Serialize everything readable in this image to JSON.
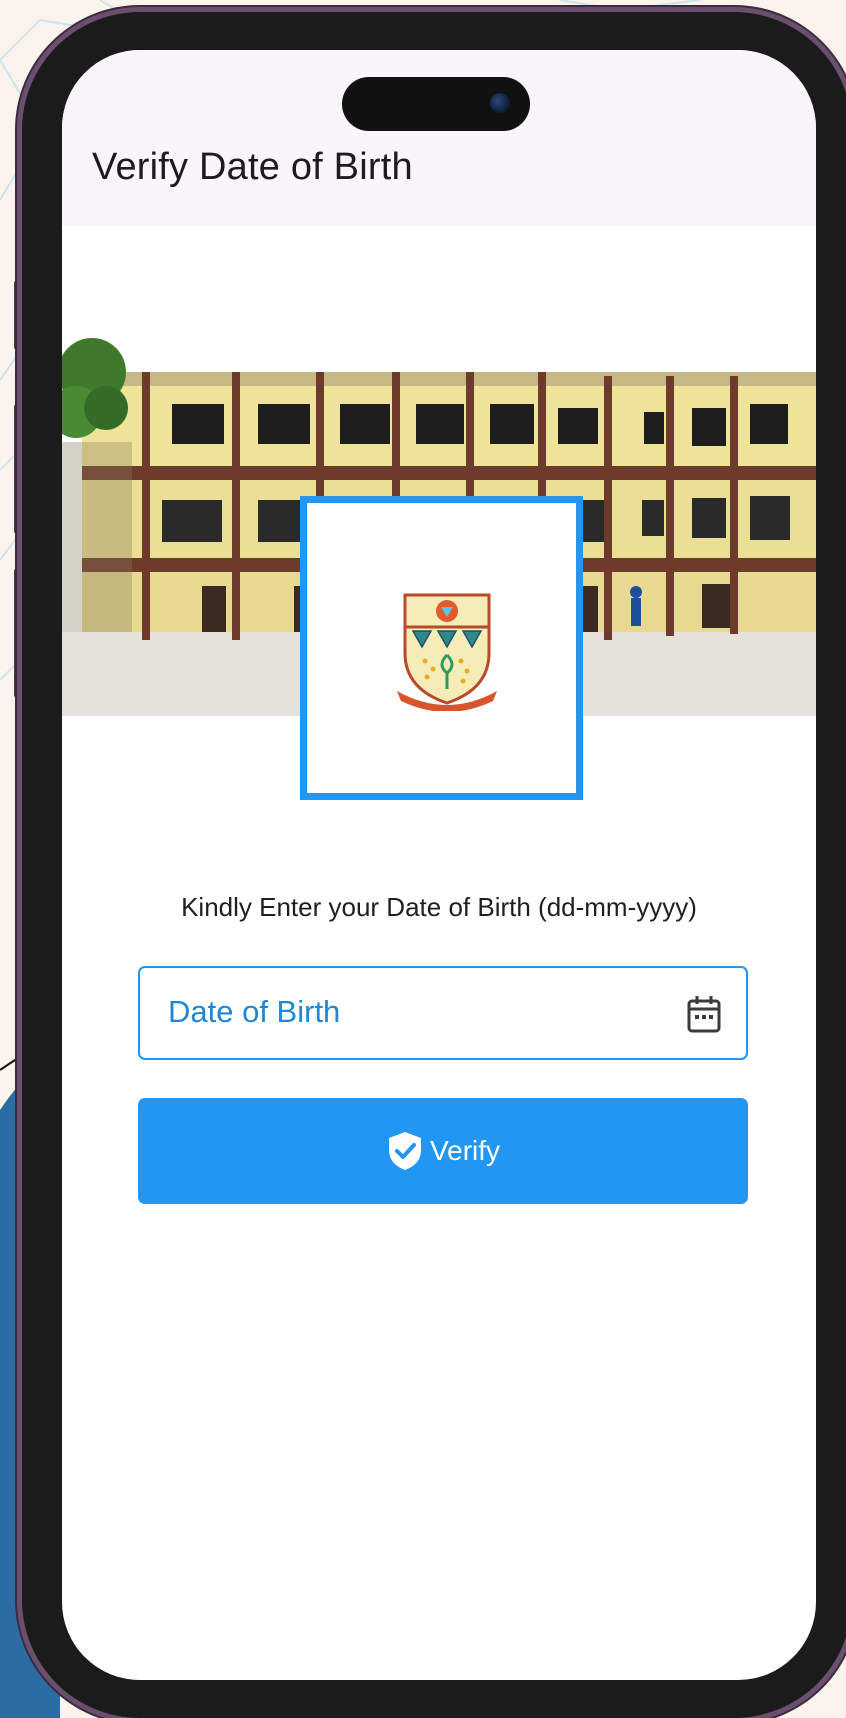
{
  "app_bar": {
    "title": "Verify Date of Birth"
  },
  "form": {
    "prompt": "Kindly Enter your Date of Birth (dd-mm-yyyy)",
    "dob_label": "Date of Birth",
    "verify_label": "Verify"
  },
  "colors": {
    "primary": "#2196f3",
    "app_bar_bg": "#faf5fb",
    "page_bg": "#fbf4ec",
    "phone_frame": "#6b4f6e"
  },
  "icons": {
    "date_picker": "calendar-icon",
    "verify": "shield-check-icon",
    "camera": "front-camera-icon"
  }
}
